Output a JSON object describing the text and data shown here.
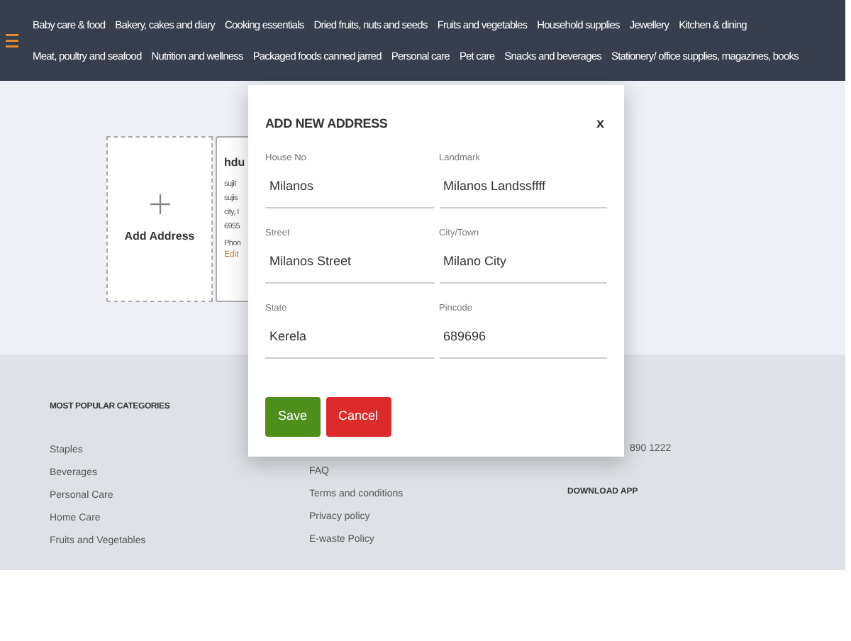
{
  "nav": {
    "rows": [
      [
        "Baby care & food",
        "Bakery, cakes and diary",
        "Cooking essentials",
        "Dried fruits, nuts and seeds",
        "Fruits and vegetables",
        "Household supplies",
        "Jewellery",
        "Kitchen & dining"
      ],
      [
        "Meat, poultry and seafood",
        "Nutrition and wellness",
        "Packaged foods canned jarred",
        "Personal care",
        "Pet care",
        "Snacks and beverages",
        "Stationery/ office supplies, magazines, books"
      ]
    ]
  },
  "add_address": {
    "label": "Add Address"
  },
  "address_card": {
    "name": "hdu",
    "lines": [
      "sujit",
      "sujis",
      "city, I",
      "6955"
    ],
    "phone": "Phon",
    "edit": "Edit"
  },
  "modal": {
    "title": "ADD NEW ADDRESS",
    "close": "x",
    "fields": [
      {
        "label": "House No",
        "value": "Milanos"
      },
      {
        "label": "Landmark",
        "value": "Milanos Landssffff"
      },
      {
        "label": "Street",
        "value": "Milanos Street"
      },
      {
        "label": "City/Town",
        "value": "Milano City"
      },
      {
        "label": "State",
        "value": "Kerela"
      },
      {
        "label": "Pincode",
        "value": "689696"
      }
    ],
    "buttons": [
      {
        "label": "Save",
        "kind": "primary"
      },
      {
        "label": "Cancel",
        "kind": "danger"
      }
    ]
  },
  "footer": {
    "columns": [
      {
        "heading": "MOST POPULAR CATEGORIES",
        "links": [
          "Staples",
          "Beverages",
          "Personal Care",
          "Home Care",
          "Fruits and Vegetables"
        ]
      },
      {
        "links": [
          "FAQ",
          "Terms and conditions",
          "Privacy policy",
          "E-waste Policy"
        ]
      },
      {
        "phone": "890 1222",
        "heading2": "DOWNLOAD APP"
      }
    ]
  }
}
